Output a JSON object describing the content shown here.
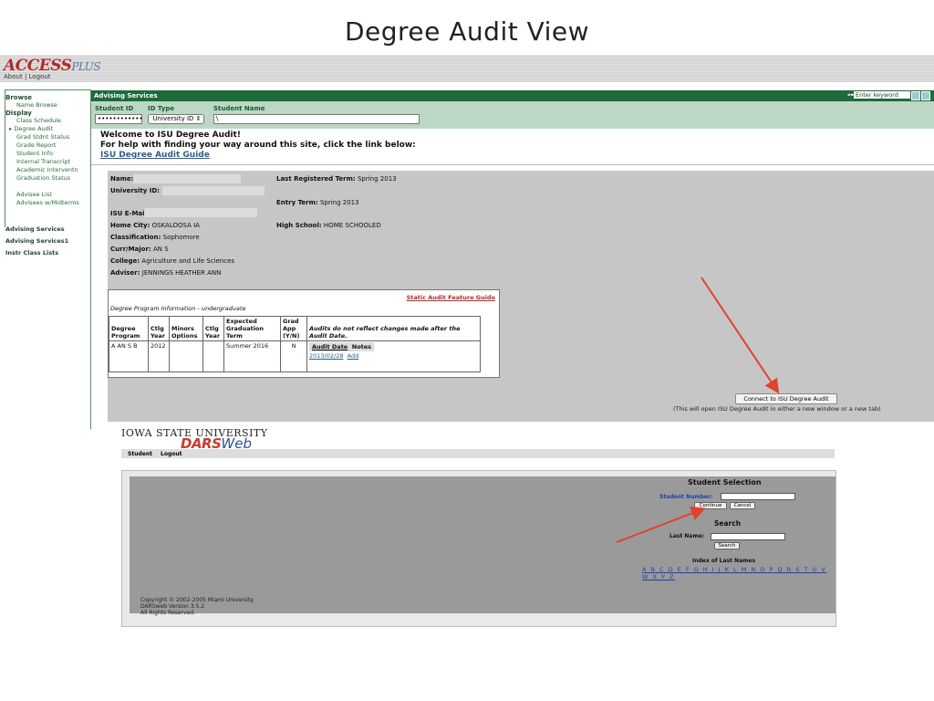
{
  "slide": {
    "title": "Degree Audit View"
  },
  "accessplus": {
    "logo_main": "ACCESS",
    "logo_plus": "PLUS",
    "about": "About",
    "sep": "|",
    "logout": "Logout"
  },
  "sidebar": {
    "browse": "Browse",
    "name_browse": "Name Browse",
    "display": "Display",
    "items": [
      "Class Schedule",
      "Degree Audit",
      "Grad Stdnt Status",
      "Grade Report",
      "Student Info",
      "Internal Transcript",
      "Academic Interventn",
      "Graduation Status"
    ],
    "advisee_list": "Advisee List",
    "advisees_midterms": "Advisees w/Midterms",
    "advising_services": "Advising Services",
    "advising_services1": "Advising Services1",
    "instr_class_lists": "Instr Class Lists"
  },
  "advising": {
    "bar_label": "Advising Services",
    "keyword_placeholder": "Enter keyword",
    "student_id_label": "Student ID",
    "student_id_value": "••••••••••••",
    "id_type_label": "ID Type",
    "id_type_value": "University ID",
    "student_name_label": "Student Name",
    "student_name_value": "\\"
  },
  "welcome": {
    "line1": "Welcome to ISU Degree Audit!",
    "line2": "For help with finding your way around this site, click the link below:",
    "guide_link": "ISU Degree Audit Guide"
  },
  "student_info": {
    "name_label": "Name:",
    "university_id_label": "University ID:",
    "email_label": "ISU E-Mail",
    "home_city_label": "Home City:",
    "home_city": "OSKALOOSA IA",
    "classification_label": "Classification:",
    "classification": "Sophomore",
    "curr_major_label": "Curr/Major:",
    "curr_major": "AN S",
    "college_label": "College:",
    "college": "Agriculture and Life Sciences",
    "adviser_label": "Adviser:",
    "adviser": "JENNINGS HEATHER ANN",
    "last_term_label": "Last Registered Term:",
    "last_term": "Spring 2013",
    "entry_term_label": "Entry Term:",
    "entry_term": "Spring 2013",
    "high_school_label": "High School:",
    "high_school": "HOME SCHOOLED"
  },
  "degree_table": {
    "static_link": "Static Audit Feature Guide",
    "section_title": "Degree Program Information - undergraduate",
    "headers": [
      "Degree Program",
      "Ctlg Year",
      "Minors Options",
      "Ctlg Year",
      "Expected Graduation Term",
      "Grad App (Y/N)",
      "Audits do not reflect changes made after the Audit Date."
    ],
    "row": {
      "program": "A AN S B",
      "ctlg_year": "2012",
      "minors": "",
      "ctlg_year2": "",
      "grad_term": "Summer 2016",
      "grad_app": "N"
    },
    "audit_date_label": "Audit Date",
    "notes_label": "Notes",
    "audit_date": "2013/02/28",
    "add_link": "Add"
  },
  "connect": {
    "button": "Connect to ISU Degree Audit",
    "note": "(This will open ISU Degree Audit in either a new window or a new tab)"
  },
  "dars": {
    "isu": "IOWA STATE UNIVERSITY",
    "dars": "DARS",
    "web": "Web",
    "nav_student": "Student",
    "nav_logout": "Logout",
    "student_selection": "Student Selection",
    "student_number_label": "Student Number:",
    "continue": "Continue",
    "cancel": "Cancel",
    "search_heading": "Search",
    "last_name_label": "Last Name:",
    "search_button": "Search",
    "index_heading": "Index of Last Names",
    "letters": "A B C D E F G H I J K L M N O P Q R S T U V W X Y Z",
    "copyright1": "Copyright © 2002-2005 Miami University.",
    "copyright2": "DARSweb Version 3.5.2",
    "copyright3": "All Rights Reserved."
  },
  "colors": {
    "arrow": "#e0432c",
    "advising_green": "#1d6b3a",
    "panel_grey": "#c6c6c6"
  }
}
